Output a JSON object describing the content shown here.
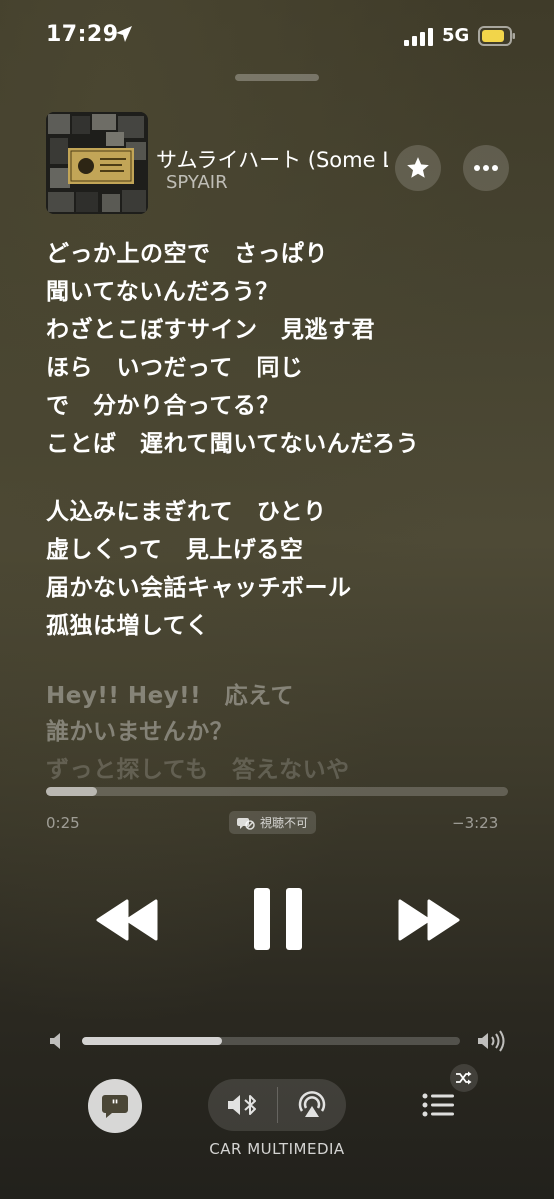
{
  "status_bar": {
    "time": "17:29",
    "network": "5G"
  },
  "now_playing": {
    "title": "サムライハート (Some Like It Hot!!)",
    "artist": "SPYAIR"
  },
  "lyrics": {
    "lines": [
      "どっか上の空で　さっぱり",
      "聞いてないんだろう？",
      "わざとこぼすサイン　見逃す君",
      "ほら　いつだって　同じ",
      "で　分かり合ってる？",
      "ことば　遅れて聞いてないんだろう",
      "人込みにまぎれて　ひとり",
      "虚しくって　見上げる空",
      "届かない会話キャッチボール",
      "孤独は増してく",
      "Hey!! Hey!!　応えて",
      "誰かいませんか？",
      "ずっと探しても　答えないや"
    ]
  },
  "playback": {
    "elapsed": "0:25",
    "remaining": "−3:23",
    "progress_fraction": 0.11,
    "badge_label": "視聴不可"
  },
  "volume": {
    "level_fraction": 0.37
  },
  "output_device": {
    "label": "CAR MULTIMEDIA"
  },
  "icons": {
    "location": "location-arrow-icon",
    "favorite": "star-icon",
    "more": "ellipsis-icon",
    "rewind": "rewind-icon",
    "pause": "pause-icon",
    "forward": "fast-forward-icon",
    "lyrics": "quote-bubble-icon",
    "bluetooth_audio": "speaker-bluetooth-icon",
    "airplay": "airplay-icon",
    "queue": "list-icon",
    "shuffle": "shuffle-icon"
  },
  "colors": {
    "battery": "#f2d54a",
    "background": "#45412f"
  }
}
